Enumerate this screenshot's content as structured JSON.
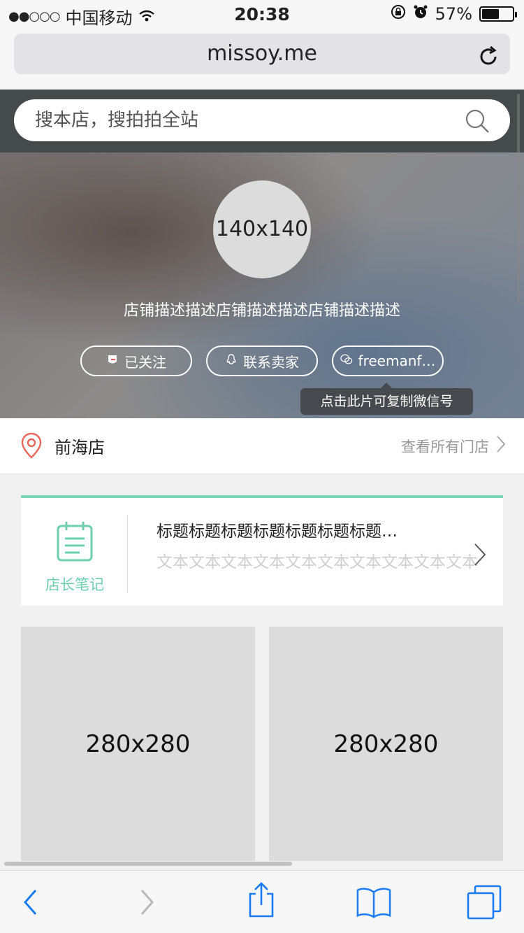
{
  "status_bar": {
    "signal_dots": "●●○○○",
    "carrier": "中国移动",
    "time": "20:38",
    "battery_percent": "57%",
    "battery_level": 0.57
  },
  "browser": {
    "url": "missoy.me"
  },
  "search": {
    "placeholder": "搜本店，搜拍拍全站"
  },
  "shop": {
    "avatar_placeholder": "140x140",
    "description": "店铺描述描述店铺描述描述店铺描述描述",
    "buttons": {
      "follow": "已关注",
      "contact": "联系卖家",
      "wechat": "freemanf…"
    },
    "tooltip": "点击此片可复制微信号"
  },
  "store": {
    "name": "前海店",
    "view_all": "查看所有门店"
  },
  "notes": {
    "label": "店长笔记",
    "title": "标题标题标题标题标题标题标题…",
    "text": "文本文本文本文本文本文本文本文本文本文本"
  },
  "products": [
    {
      "placeholder": "280x280"
    },
    {
      "placeholder": "280x280"
    }
  ],
  "colors": {
    "accent_green": "#6ecfae",
    "pin_red": "#e8665a",
    "ios_blue": "#1a7cf2"
  }
}
